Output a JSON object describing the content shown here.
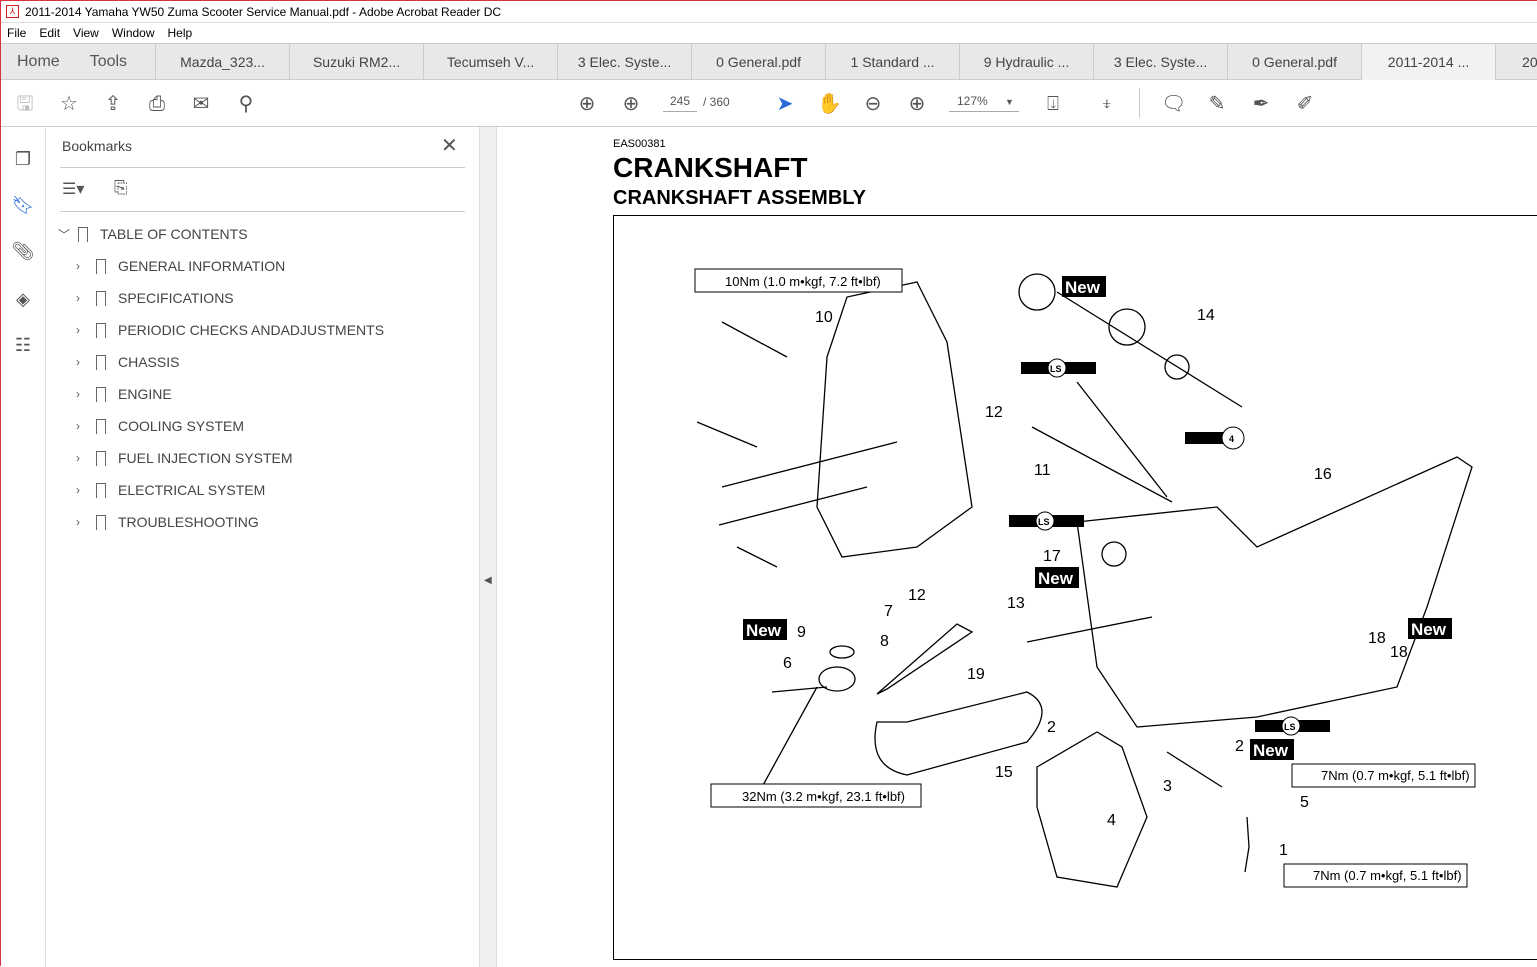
{
  "window": {
    "title": "2011-2014 Yamaha YW50 Zuma Scooter Service Manual.pdf - Adobe Acrobat Reader DC"
  },
  "menu": [
    "File",
    "Edit",
    "View",
    "Window",
    "Help"
  ],
  "tabs": {
    "home": "Home",
    "tools": "Tools",
    "docs": [
      "Mazda_323...",
      "Suzuki RM2...",
      "Tecumseh V...",
      "3 Elec. Syste...",
      "0 General.pdf",
      "1 Standard ...",
      "9 Hydraulic ...",
      "3 Elec. Syste...",
      "0 General.pdf",
      "2011-2014 ...",
      "20"
    ]
  },
  "toolbar": {
    "page_current": "245",
    "page_total": "/ 360",
    "zoom": "127%"
  },
  "bookmarks": {
    "title": "Bookmarks",
    "root": "TABLE OF CONTENTS",
    "items": [
      "GENERAL INFORMATION",
      "SPECIFICATIONS",
      "PERIODIC CHECKS ANDADJUSTMENTS",
      "CHASSIS",
      "ENGINE",
      "COOLING SYSTEM",
      "FUEL INJECTION SYSTEM",
      "ELECTRICAL SYSTEM",
      "TROUBLESHOOTING"
    ]
  },
  "page": {
    "code": "EAS00381",
    "title": "CRANKSHAFT",
    "subtitle": "CRANKSHAFT ASSEMBLY",
    "torque": [
      "10Nm (1.0 m•kgf, 7.2 ft•lbf)",
      "32Nm (3.2 m•kgf, 23.1 ft•lbf)",
      "7Nm (0.7 m•kgf, 5.1 ft•lbf)",
      "7Nm (0.7 m•kgf, 5.1 ft•lbf)"
    ],
    "new_label": "New",
    "ls_label": "LS",
    "four_label": "4",
    "parts": [
      "10",
      "14",
      "12",
      "11",
      "16",
      "17",
      "13",
      "12",
      "7",
      "8",
      "9",
      "6",
      "19",
      "15",
      "2",
      "18",
      "18",
      "2",
      "3",
      "5",
      "4",
      "1"
    ]
  }
}
